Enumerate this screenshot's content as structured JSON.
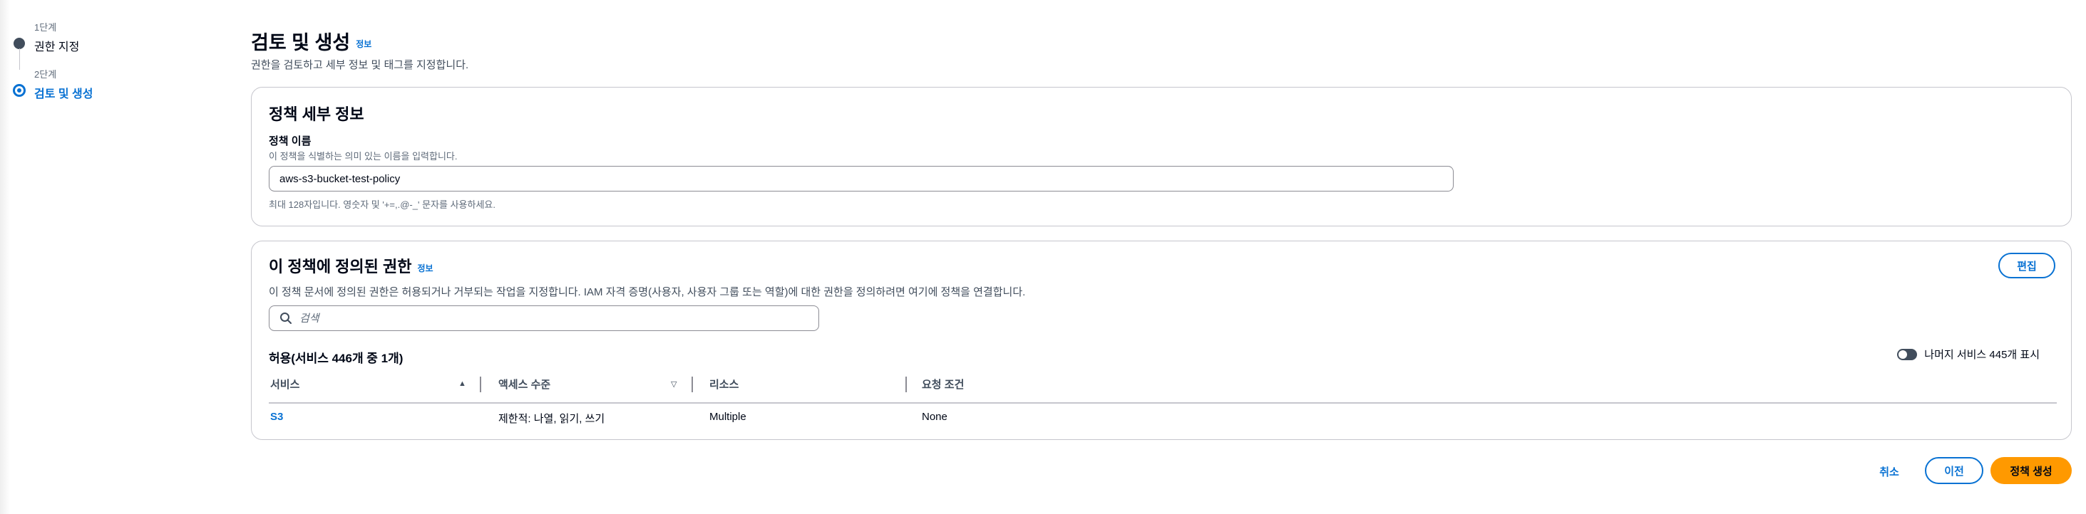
{
  "steps": [
    {
      "caption": "1단계",
      "title": "권한 지정",
      "state": "done"
    },
    {
      "caption": "2단계",
      "title": "검토 및 생성",
      "state": "active"
    }
  ],
  "header": {
    "title": "검토 및 생성",
    "info": "정보",
    "description": "권한을 검토하고 세부 정보 및 태그를 지정합니다."
  },
  "policy_details": {
    "title": "정책 세부 정보",
    "name_label": "정책 이름",
    "name_description": "이 정책을 식별하는 의미 있는 이름을 입력합니다.",
    "name_value": "aws-s3-bucket-test-policy",
    "name_hint": "최대 128자입니다. 영숫자 및 '+=,.@-_' 문자를 사용하세요."
  },
  "permissions": {
    "title": "이 정책에 정의된 권한",
    "info": "정보",
    "edit_label": "편집",
    "description": "이 정책 문서에 정의된 권한은 허용되거나 거부되는 작업을 지정합니다. IAM 자격 증명(사용자, 사용자 그룹 또는 역할)에 대한 권한을 정의하려면 여기에 정책을 연결합니다.",
    "search_placeholder": "검색",
    "table_title": "허용(서비스 446개 중 1개)",
    "toggle_label": "나머지 서비스 445개 표시",
    "toggle_on": false,
    "columns": [
      "서비스",
      "액세스 수준",
      "리소스",
      "요청 조건"
    ],
    "sort_glyphs": [
      "▲",
      "▽"
    ],
    "rows": [
      {
        "service": "S3",
        "access": "제한적: 나열, 읽기, 쓰기",
        "resource": "Multiple",
        "condition": "None"
      }
    ]
  },
  "footer": {
    "cancel_label": "취소",
    "prev_label": "이전",
    "create_label": "정책 생성"
  },
  "colors": {
    "accent": "#0972d3",
    "primary_button": "#ff9900",
    "text": "#000716",
    "muted_text": "#5f6b7a"
  }
}
